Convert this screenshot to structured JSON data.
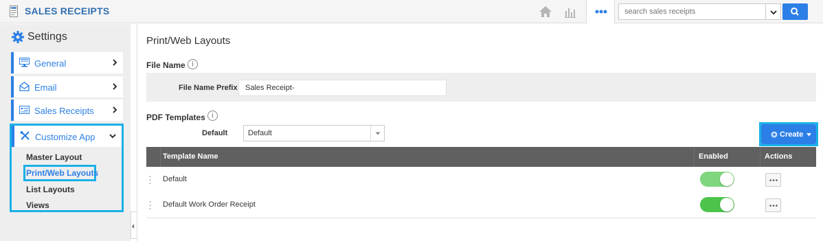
{
  "app": {
    "title": "SALES RECEIPTS",
    "icon": "receipt-icon"
  },
  "topbar": {
    "home_icon": "home-icon",
    "chart_icon": "bar-chart-icon",
    "more_icon": "more-dots-icon",
    "search": {
      "placeholder": "search sales receipts",
      "value": ""
    },
    "search_icon": "search-icon"
  },
  "sidebar": {
    "heading": "Settings",
    "heading_icon": "gear-icon",
    "items": [
      {
        "label": "General",
        "icon": "monitor-icon"
      },
      {
        "label": "Email",
        "icon": "envelope-icon"
      },
      {
        "label": "Sales Receipts",
        "icon": "receipt-list-icon"
      },
      {
        "label": "Customize App",
        "icon": "tools-icon",
        "expanded": true
      }
    ],
    "submenu": [
      {
        "label": "Master Layout",
        "active": false
      },
      {
        "label": "Print/Web Layouts",
        "active": true
      },
      {
        "label": "List Layouts",
        "active": false
      },
      {
        "label": "Views",
        "active": false
      }
    ],
    "collapse_glyph": "‹"
  },
  "main": {
    "title": "Print/Web Layouts",
    "file_name": {
      "label": "File Name",
      "info": "i",
      "prefix_label": "File Name Prefix",
      "prefix_value": "Sales Receipt-"
    },
    "pdf_templates": {
      "label": "PDF Templates",
      "info": "i",
      "default_label": "Default",
      "default_value": "Default",
      "create_label": "Create"
    },
    "table": {
      "columns": [
        "Template Name",
        "Enabled",
        "Actions"
      ],
      "rows": [
        {
          "name": "Default",
          "enabled": true
        },
        {
          "name": "Default Work Order Receipt",
          "enabled": true
        }
      ]
    }
  },
  "colors": {
    "accent": "#2c7fe6",
    "highlight": "#1ab0e8",
    "toggle_on": "#4cc44c",
    "header_bg": "#606060"
  }
}
